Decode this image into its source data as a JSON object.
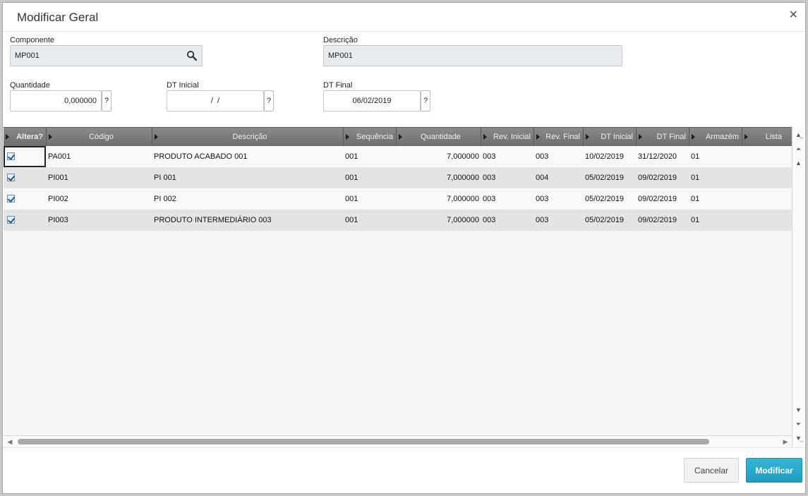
{
  "dialog": {
    "title": "Modificar Geral",
    "close_glyph": "✕"
  },
  "form": {
    "componente": {
      "label": "Componente",
      "value": "MP001"
    },
    "descricao": {
      "label": "Descrição",
      "value": "MP001"
    },
    "quantidade": {
      "label": "Quantidade",
      "value": "0,000000"
    },
    "dt_inicial": {
      "label": "DT Inicial",
      "value": " /  / "
    },
    "dt_final": {
      "label": "DT Final",
      "value": "06/02/2019"
    },
    "help_label": "?"
  },
  "grid": {
    "columns": [
      "Altera?",
      "Código",
      "Descrição",
      "Sequência",
      "Quantidade",
      "Rev. Inicial",
      "Rev. Final",
      "DT Inicial",
      "DT Final",
      "Armazém",
      "Lista"
    ],
    "rows": [
      {
        "altera": true,
        "codigo": "PA001",
        "descricao": "PRODUTO ACABADO 001",
        "sequencia": "001",
        "quantidade": "7,000000",
        "rev_inicial": "003",
        "rev_final": "003",
        "dt_inicial": "10/02/2019",
        "dt_final": "31/12/2020",
        "armazem": "01",
        "lista": ""
      },
      {
        "altera": true,
        "codigo": "PI001",
        "descricao": "PI 001",
        "sequencia": "001",
        "quantidade": "7,000000",
        "rev_inicial": "003",
        "rev_final": "004",
        "dt_inicial": "05/02/2019",
        "dt_final": "09/02/2019",
        "armazem": "01",
        "lista": ""
      },
      {
        "altera": true,
        "codigo": "PI002",
        "descricao": "PI 002",
        "sequencia": "001",
        "quantidade": "7,000000",
        "rev_inicial": "003",
        "rev_final": "003",
        "dt_inicial": "05/02/2019",
        "dt_final": "09/02/2019",
        "armazem": "01",
        "lista": ""
      },
      {
        "altera": true,
        "codigo": "PI003",
        "descricao": "PRODUTO INTERMEDIÁRIO 003",
        "sequencia": "001",
        "quantidade": "7,000000",
        "rev_inicial": "003",
        "rev_final": "003",
        "dt_inicial": "05/02/2019",
        "dt_final": "09/02/2019",
        "armazem": "01",
        "lista": ""
      }
    ]
  },
  "buttons": {
    "cancel": "Cancelar",
    "modify": "Modificar"
  },
  "colors": {
    "primary": "#2aa9cc",
    "header": "#7c7c7c"
  }
}
